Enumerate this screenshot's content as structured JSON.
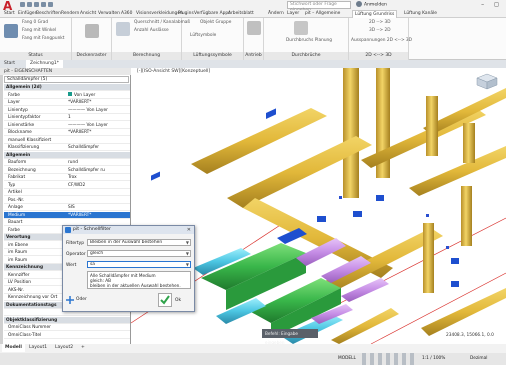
{
  "app": {
    "logo": "A",
    "search_placeholder": "Stichwort oder Frage eingeben",
    "signin_label": "Anmelden",
    "window_controls": "– ◻ ✕"
  },
  "ribbon_tabs": [
    "Start",
    "Einfügen",
    "Beschriften",
    "Rendern",
    "Ansicht",
    "Verwalten",
    "A360",
    "Visionsverkleidungen",
    "Plugins",
    "Verfügbare Apps",
    "Arbeitsblatt",
    "Ändern",
    "Layer",
    "pit – Allgemeine",
    "Lüftung Grundriss",
    "Lüftung Kanäle"
  ],
  "active_tab": "Lüftung Grundriss",
  "ribbon": {
    "qat_icons": [
      "save-icon",
      "undo-icon",
      "redo-icon",
      "print-icon",
      "plot-icon"
    ],
    "panels": [
      {
        "title": "Status",
        "buttons": [
          "Fang 0 Grad",
          "Fang mit Winkel",
          "Fang mit Fangpunkt"
        ],
        "big": "Status"
      },
      {
        "title": "Deckenraster",
        "buttons": [
          "Deckenraster"
        ]
      },
      {
        "title": "Berechnung",
        "buttons": [
          "Querschnitt / Kanalabmaß",
          "Anzahl Auslässe"
        ]
      },
      {
        "title": "Lüftungssymbole",
        "buttons": [
          "Lüftsymbole",
          "Objekt Gruppe"
        ]
      },
      {
        "title": "Antrieb",
        "buttons": [
          "Antrieb"
        ]
      },
      {
        "title": "Durchbrüche",
        "buttons": [
          "Durchbruchs Planung"
        ]
      },
      {
        "title": "2D <--> 3D",
        "buttons": [
          "2D --> 3D",
          "3D --> 2D",
          "Ausspannungen 2D <--> 3D"
        ]
      }
    ]
  },
  "file_tabs": [
    "Start",
    "Zeichnung1*"
  ],
  "active_file_tab": "Zeichnung1*",
  "properties": {
    "title": "pit - EIGENSCHAFTEN",
    "selection": "Schalldämpfer (5)",
    "rows": [
      {
        "k": "Allgemein (2d)",
        "cat": true
      },
      {
        "k": "Farbe",
        "v": "Von Layer",
        "swatch": true
      },
      {
        "k": "Layer",
        "v": "*VARIIERT*"
      },
      {
        "k": "Linientyp",
        "v": "———— Von Layer"
      },
      {
        "k": "Linientypfaktor",
        "v": "1"
      },
      {
        "k": "Linienstärke",
        "v": "———— Von Layer"
      },
      {
        "k": "Blockname",
        "v": "*VARIIERT*"
      },
      {
        "k": "manuell Klassifiziert",
        "v": ""
      },
      {
        "k": "Klassifizierung",
        "v": "Schalldämpfer"
      },
      {
        "k": "Allgemein",
        "cat": true
      },
      {
        "k": "Bauform",
        "v": "rund"
      },
      {
        "k": "Bezeichnung",
        "v": "Schalldämpfer ru"
      },
      {
        "k": "Fabrikat",
        "v": "Trox"
      },
      {
        "k": "Typ",
        "v": "CF/WD2"
      },
      {
        "k": "Artikel",
        "v": ""
      },
      {
        "k": "Pos.-Nr.",
        "v": ""
      },
      {
        "k": "Anlage",
        "v": "SIS"
      },
      {
        "k": "Medium",
        "v": "*VARIIERT*",
        "sel": true
      },
      {
        "k": "Bauart",
        "v": ""
      },
      {
        "k": "Farbe",
        "v": ""
      },
      {
        "k": "Verortung",
        "cat": true
      },
      {
        "k": "im Ebene",
        "v": ""
      },
      {
        "k": "im Raum",
        "v": ""
      },
      {
        "k": "im Raum",
        "v": ""
      },
      {
        "k": "Kennzeichnung",
        "cat": true
      },
      {
        "k": "Kennziffer",
        "v": ""
      },
      {
        "k": "LV Position",
        "v": ""
      },
      {
        "k": "AKS-Nr.",
        "v": ""
      },
      {
        "k": "Kennzeichnung vor Ort",
        "v": ""
      },
      {
        "k": "Dokumentationstags",
        "cat": true
      },
      {
        "k": "",
        "v": ""
      },
      {
        "k": "Objektklassifizierung",
        "cat": true
      },
      {
        "k": "OmniClass Nummer",
        "v": ""
      },
      {
        "k": "OmniClass-Titel",
        "v": ""
      }
    ]
  },
  "viewport": {
    "label": "[-][ISO-Ansicht SW][Konzeptuell]",
    "coord_readout": "23408.3, 15066.1, 0.0",
    "command_line": "Befehl: Eingabe eingeben"
  },
  "layout_tabs": [
    "Modell",
    "Layout1",
    "Layout2",
    "+"
  ],
  "active_layout_tab": "Modell",
  "status_bar": {
    "model_label": "MODELL",
    "scale": "1:1 / 100%",
    "units": "Dezimal"
  },
  "dialog": {
    "title": "pit - Schnellfilter",
    "close": "✕",
    "fields": [
      {
        "label": "Filtertyp",
        "value": "Bleiben in der Auswahl bestehen"
      },
      {
        "label": "Operator",
        "value": "gleich"
      },
      {
        "label": "Wert",
        "value": "sa"
      }
    ],
    "note_line1": "Alle Schalldämpfer mit Medium",
    "note_line2": "gleich: AB",
    "note_line3": "bleiben in der aktuellen Auswahl bestehen.",
    "add_label": "Oder",
    "ok_label": "Ok"
  },
  "colors": {
    "accent": "#2a75d0",
    "pipe_yellow": "#e8c44a",
    "pipe_green": "#3db54a",
    "pipe_cyan": "#5ad2e8",
    "pipe_purple": "#c890e8",
    "red_line": "#d9302c"
  }
}
